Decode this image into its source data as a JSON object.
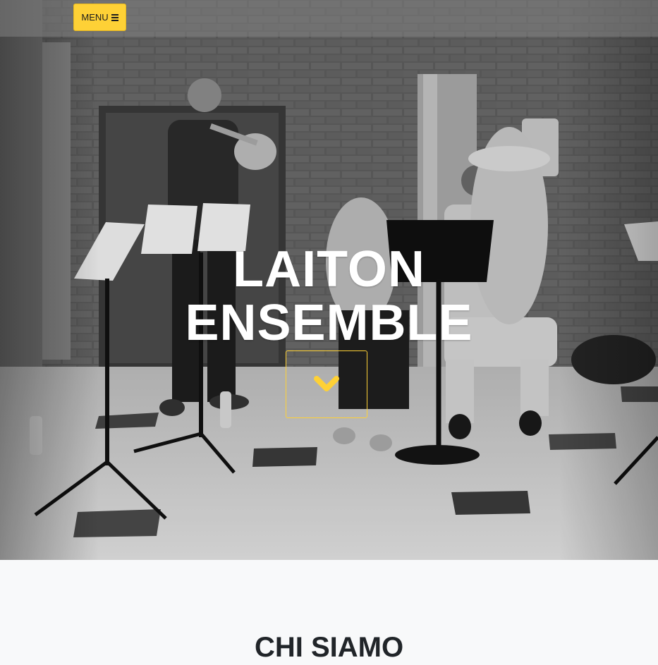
{
  "navbar": {
    "menu_label": "MENU",
    "menu_icon": "bars-icon",
    "menu_color": "#fed136"
  },
  "hero": {
    "title_line1": "LAITON",
    "title_line2": "ENSEMBLE",
    "scroll_icon": "chevron-down-icon",
    "accent_color": "#fed136"
  },
  "about": {
    "heading": "CHI SIAMO"
  }
}
